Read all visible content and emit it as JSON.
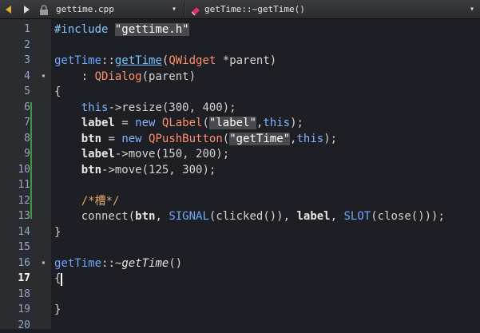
{
  "toolbar": {
    "file_name": "gettime.cpp",
    "file_dropdown": "▾",
    "symbol_name": "getTime::~getTime()",
    "symbol_dropdown": "▾",
    "back_icon": "back-arrow-icon",
    "forward_icon": "forward-arrow-icon"
  },
  "gutter": {
    "line_numbers": [
      "1",
      "2",
      "3",
      "4",
      "5",
      "6",
      "7",
      "8",
      "9",
      "10",
      "11",
      "12",
      "13",
      "14",
      "15",
      "16",
      "17",
      "18",
      "19",
      "20"
    ],
    "current_line": "17"
  },
  "code": {
    "l1": {
      "a": "#include ",
      "b": "\"gettime.h\""
    },
    "l3": {
      "a": "getTime",
      "b": "::",
      "c": "getTime",
      "d": "(",
      "e": "QWidget",
      "f": " *parent)"
    },
    "l4": {
      "a": "    : ",
      "b": "QDialog",
      "c": "(parent)"
    },
    "l5": {
      "a": "{"
    },
    "l6": {
      "a": "    ",
      "b": "this",
      "c": "->resize(300, 400);"
    },
    "l7": {
      "a": "    ",
      "b": "label",
      "c": " = ",
      "d": "new ",
      "e": "QLabel",
      "f": "(",
      "g": "\"label\"",
      ",h": "",
      "h": ",",
      "i": "this",
      "j": ");"
    },
    "l8": {
      "a": "    ",
      "b": "btn",
      "c": " = ",
      "d": "new ",
      "e": "QPushButton",
      "f": "(",
      "g": "\"getTime\"",
      "h": ",",
      "i": "this",
      "j": ");"
    },
    "l9": {
      "a": "    ",
      "b": "label",
      "c": "->move(150, 200);"
    },
    "l10": {
      "a": "    ",
      "b": "btn",
      "c": "->move(125, 300);"
    },
    "l12": {
      "a": "    ",
      "b": "/*槽*/"
    },
    "l13": {
      "a": "    connect(",
      "b": "btn",
      "c": ", ",
      "d": "SIGNAL",
      "e": "(clicked()), ",
      "f": "label",
      "g": ", ",
      "h": "SLOT",
      "i": "(close()));"
    },
    "l14": {
      "a": "}"
    },
    "l16": {
      "a": "getTime",
      "b": "::~",
      "c": "getTime",
      "d": "()"
    },
    "l17": {
      "a": "{"
    },
    "l19": {
      "a": "}"
    }
  }
}
